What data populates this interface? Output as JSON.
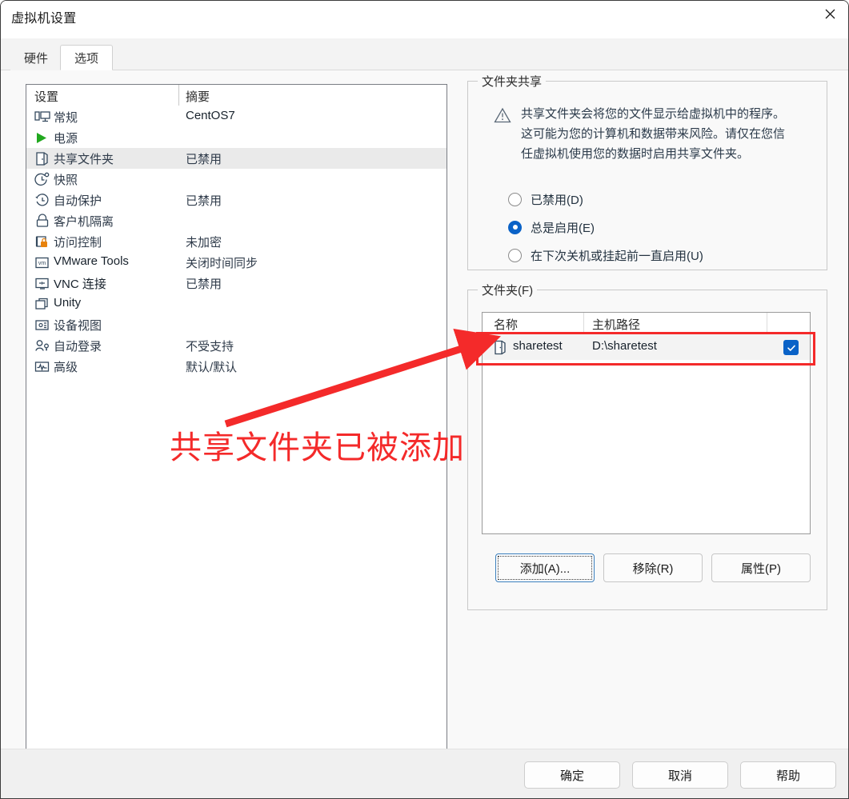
{
  "window": {
    "title": "虚拟机设置",
    "close_icon": "close-icon"
  },
  "tabs": [
    {
      "label": "硬件",
      "active": false
    },
    {
      "label": "选项",
      "active": true
    }
  ],
  "settings_list": {
    "headers": {
      "name": "设置",
      "summary": "摘要"
    },
    "rows": [
      {
        "icon": "monitor-icon",
        "label": "常规",
        "summary": "CentOS7",
        "selected": false,
        "latin_summary": true
      },
      {
        "icon": "power-play-icon",
        "label": "电源",
        "summary": "",
        "selected": false
      },
      {
        "icon": "shared-folder-icon",
        "label": "共享文件夹",
        "summary": "已禁用",
        "selected": true
      },
      {
        "icon": "snapshot-clock-icon",
        "label": "快照",
        "summary": "",
        "selected": false
      },
      {
        "icon": "autoprotect-icon",
        "label": "自动保护",
        "summary": "已禁用",
        "selected": false
      },
      {
        "icon": "lock-icon",
        "label": "客户机隔离",
        "summary": "",
        "selected": false
      },
      {
        "icon": "access-control-icon",
        "label": "访问控制",
        "summary": "未加密",
        "selected": false
      },
      {
        "icon": "vmware-tools-icon",
        "label": "VMware Tools",
        "summary": "关闭时间同步",
        "selected": false,
        "latin_label": true
      },
      {
        "icon": "vnc-icon",
        "label": "VNC 连接",
        "summary": "已禁用",
        "selected": false,
        "latin_label": true
      },
      {
        "icon": "unity-icon",
        "label": "Unity",
        "summary": "",
        "selected": false,
        "latin_label": true
      },
      {
        "icon": "device-view-icon",
        "label": "设备视图",
        "summary": "",
        "selected": false
      },
      {
        "icon": "auto-login-icon",
        "label": "自动登录",
        "summary": "不受支持",
        "selected": false
      },
      {
        "icon": "advanced-icon",
        "label": "高级",
        "summary": "默认/默认",
        "selected": false
      }
    ]
  },
  "folder_sharing": {
    "group_title": "文件夹共享",
    "warning_icon": "warning-triangle-icon",
    "warning_text": "共享文件夹会将您的文件显示给虚拟机中的程序。这可能为您的计算机和数据带来风险。请仅在您信任虚拟机使用您的数据时启用共享文件夹。",
    "options": [
      {
        "label": "已禁用(D)",
        "selected": false
      },
      {
        "label": "总是启用(E)",
        "selected": true
      },
      {
        "label": "在下次关机或挂起前一直启用(U)",
        "selected": false
      }
    ]
  },
  "folders": {
    "group_title": "文件夹(F)",
    "columns": [
      "名称",
      "主机路径",
      ""
    ],
    "rows": [
      {
        "icon": "folder-icon",
        "name": "sharetest",
        "host_path": "D:\\sharetest",
        "enabled": true,
        "checkbox_icon": "checkmark-icon"
      }
    ],
    "buttons": [
      {
        "label": "添加(A)...",
        "focused": true
      },
      {
        "label": "移除(R)",
        "focused": false
      },
      {
        "label": "属性(P)",
        "focused": false
      }
    ]
  },
  "footer_buttons": [
    {
      "label": "确定"
    },
    {
      "label": "取消"
    },
    {
      "label": "帮助"
    }
  ],
  "annotation": {
    "text": "共享文件夹已被添加",
    "color": "#f42a2a",
    "highlight_target": "shared-folder-table-row"
  },
  "colors": {
    "accent_blue": "#0a62c7",
    "annotation_red": "#f42a2a",
    "selected_row_bg": "#eaeaea",
    "dialog_bg": "#f9f9f9"
  }
}
